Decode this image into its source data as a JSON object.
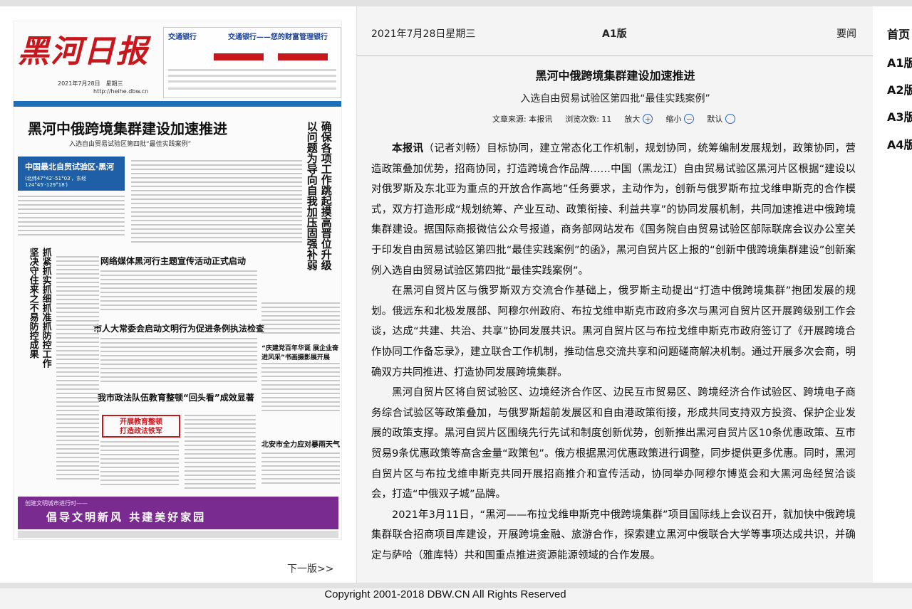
{
  "newspaper": {
    "masthead": "黑河日报",
    "issue_date": "2021年7月28日　星期三",
    "website": "http://heihe.dbw.cn",
    "ad_bank": "交通银行",
    "ad_slogan": "交通银行——您的财富管理银行",
    "headline": "黑河中俄跨境集群建设加速推进",
    "subheadline": "入选自由贸易试验区第四批“最佳实践案例”",
    "box_title": "中国最北自贸试验区·黑河",
    "box_coords": "(北纬47°42′-51°03′，东经124°45′-129°18′)",
    "vertical_head_right": "确保各项工作跳起摸高晋位升级",
    "vertical_head_right2": "以问题为导向自我加压固强补弱",
    "vertical_head_left": "抓紧抓实抓细抓准抓防控工作",
    "vertical_head_left2": "坚决守住来之不易防控成果",
    "section1": "网络媒体黑河行主题宣传活动正式启动",
    "section2": "市人大常委会启动文明行为促进条例执法检查",
    "section3": "我市政法队伍教育整顿“回头看”成效显著",
    "section4": "“庆建党百年华诞 展企业奋进风采”书画摄影展开展",
    "section5": "北安市全力应对暴雨天气",
    "red_banner": "开展教育整顿\n打造政法铁军",
    "purple_small": "创建文明城市进行时——",
    "purple_main": "倡导文明新风  共建美好家园",
    "next_page": "下一版>>"
  },
  "article": {
    "date": "2021年7月28日星期三",
    "edition": "A1版",
    "nav_label": "要闻",
    "title": "黑河中俄跨境集群建设加速推进",
    "subtitle": "入选自由贸易试验区第四批“最佳实践案例”",
    "meta": {
      "source": "文章来源: 本报讯",
      "views": "浏览次数: 11",
      "zoom_in": "放大",
      "zoom_out": "缩小",
      "default": "默认"
    },
    "lead": "本报讯",
    "paragraphs": [
      "（记者刘畅）目标协同，建立常态化工作机制，规划协同，统筹编制发展规划，政策协同，营造政策叠加优势，招商协同，打造跨境合作品牌……中国（黑龙江）自由贸易试验区黑河片区根据“建设以对俄罗斯及东北亚为重点的开放合作高地”任务要求，主动作为，创新与俄罗斯布拉戈维申斯克的合作模式，双方打造形成“规划统筹、产业互动、政策衔接、利益共享”的协同发展机制，共同加速推进中俄跨境集群建设。据国际商报微信公众号报道，商务部网站发布《国务院自由贸易试验区部际联席会议办公室关于印发自由贸易试验区第四批“最佳实践案例”的函》，黑河自贸片区上报的“创新中俄跨境集群建设”创新案例入选自由贸易试验区第四批“最佳实践案例”。",
      "在黑河自贸片区与俄罗斯双方交流合作基础上，俄罗斯主动提出“打造中俄跨境集群”抱团发展的规划。俄远东和北极发展部、阿穆尔州政府、布拉戈维申斯克市政府多次与黑河自贸片区开展跨级别工作会谈，达成“共建、共治、共享”协同发展共识。黑河自贸片区与布拉戈维申斯克市政府签订了《开展跨境合作协同工作备忘录》，建立联合工作机制，推动信息交流共享和问题磋商解决机制。通过开展多次会商，明确双方共同推进、打造协同发展跨境集群。",
      "黑河自贸片区将自贸试验区、边境经济合作区、边民互市贸易区、跨境经济合作试验区、跨境电子商务综合试验区等政策叠加，与俄罗斯超前发展区和自由港政策衔接，形成共同支持双方投资、保护企业发展的政策支撑。黑河自贸片区围绕先行先试和制度创新优势，创新推出黑河自贸片区10条优惠政策、互市贸易9条优惠政策等高含金量“政策包”。俄方根据黑河优惠政策进行调整，同步提供更多优惠。同时，黑河自贸片区与布拉戈维申斯克共同开展招商推介和宣传活动，协同举办阿穆尔博览会和大黑河岛经贸洽谈会，打造“中俄双子城”品牌。",
      "2021年3月11日，“黑河——布拉戈维申斯克中俄跨境集群”项目国际线上会议召开，就加快中俄跨境集群联合招商项目库建设，开展跨境金融、旅游合作，探索建立黑河中俄联合大学等事项达成共识，并确定与萨哈（雅库特）共和国重点推进资源能源领域的合作发展。"
    ]
  },
  "side_nav": {
    "items": [
      "首页",
      "A1版",
      "A2版",
      "A3版",
      "A4版"
    ]
  },
  "footer": {
    "copyright": "Copyright 2001-2018 DBW.CN All Rights Reserved"
  }
}
